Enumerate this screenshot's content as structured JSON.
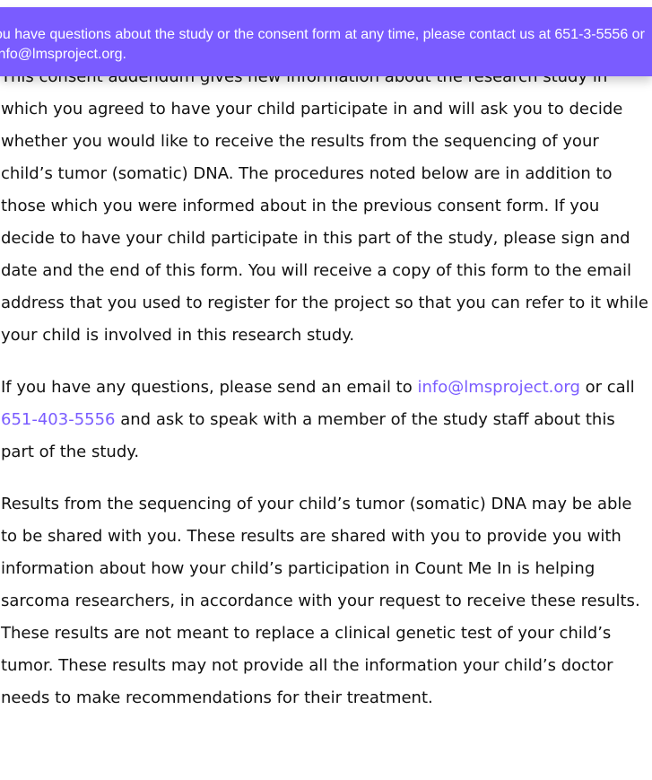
{
  "banner": {
    "text": "ou have questions about the study or the consent form at any time, please contact us at 651-3-5556 or info@lmsproject.org.",
    "color": "#7a5cff"
  },
  "content": {
    "paragraph1": "This consent addendum gives new information about the research study in which you agreed to have your child participate in and will ask you to decide whether you would like to receive the results from the sequencing of your child’s tumor (somatic) DNA. The procedures noted below are in addition to those which you were informed about in the previous consent form. If you decide to have your child participate in this part of the study, please sign and date and the end of this form. You will receive a copy of this form to the email address that you used to register for the project so that you can refer to it while your child is involved in this research study.",
    "paragraph2": {
      "before_email": "If you have any questions, please send an email to ",
      "email": "info@lmsproject.org",
      "between": " or call ",
      "phone": "651-403-5556",
      "after_phone": " and ask to speak with a member of the study staff about this part of the study."
    },
    "paragraph3": "Results from the sequencing of your child’s tumor (somatic) DNA may be able to be shared with you. These results are shared with you to provide you with information about how your child’s participation in Count Me In is helping sarcoma researchers, in accordance with your request to receive these results. These results are not meant to replace a clinical genetic test of your child’s tumor. These results may not provide all the information your child’s doctor needs to make recommendations for their treatment.",
    "link_color": "#7a5cff"
  }
}
